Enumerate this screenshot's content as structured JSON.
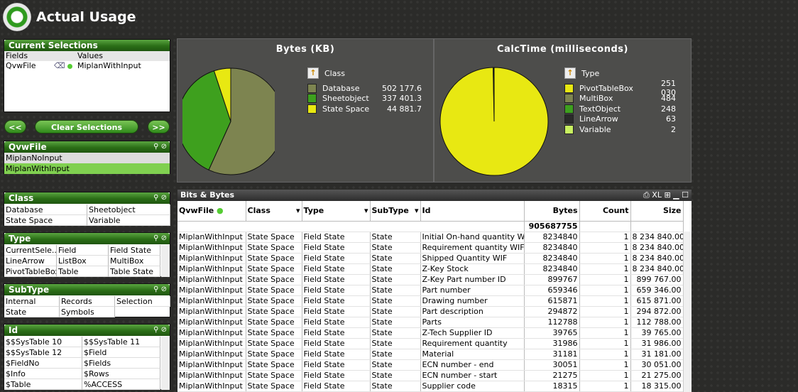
{
  "app": {
    "title": "Actual Usage"
  },
  "current_selections": {
    "title": "Current Selections",
    "col_fields": "Fields",
    "col_values": "Values",
    "rows": [
      {
        "field": "QvwFile",
        "value": "MiplanWithInput"
      }
    ]
  },
  "nav": {
    "back": "<<",
    "clear": "Clear Selections",
    "forward": ">>"
  },
  "listboxes": {
    "qvwfile": {
      "title": "QvwFile",
      "items": [
        {
          "label": "MiplanNoInput",
          "selected": false
        },
        {
          "label": "MiplanWithInput",
          "selected": true
        }
      ]
    },
    "class": {
      "title": "Class",
      "items": [
        "Database",
        "Sheetobject",
        "State Space",
        "Variable"
      ]
    },
    "type": {
      "title": "Type",
      "items": [
        "CurrentSele...",
        "Field",
        "Field State",
        "LineArrow",
        "ListBox",
        "MultiBox",
        "PivotTableBox",
        "Table",
        "Table State"
      ]
    },
    "subtype": {
      "title": "SubType",
      "items": [
        "Internal",
        "Records",
        "Selection",
        "State",
        "Symbols",
        ""
      ]
    },
    "id": {
      "title": "Id",
      "items": [
        "$$SysTable 10",
        "$$SysTable 11",
        "$$SysTable 12",
        "$Field",
        "$FieldNo",
        "$Fields",
        "$Info",
        "$Rows",
        "$Table",
        "%ACCESS"
      ]
    }
  },
  "chart_data": [
    {
      "type": "pie",
      "title": "Bytes (KB)",
      "legend_title": "Class",
      "legend": "right",
      "slices": [
        {
          "label": "Database",
          "value": 502177.6,
          "display": "502 177.6",
          "color": "#7d8450"
        },
        {
          "label": "Sheetobject",
          "value": 337401.3,
          "display": "337 401.3",
          "color": "#3ea01e"
        },
        {
          "label": "State Space",
          "value": 44881.7,
          "display": "44 881.7",
          "color": "#e8e812"
        }
      ]
    },
    {
      "type": "pie",
      "title": "CalcTime (milliseconds)",
      "legend_title": "Type",
      "legend": "right",
      "slices": [
        {
          "label": "PivotTableBox",
          "value": 251030,
          "display": "251 030",
          "color": "#e8e812"
        },
        {
          "label": "MultiBox",
          "value": 484,
          "display": "484",
          "color": "#7d8450"
        },
        {
          "label": "TextObject",
          "value": 248,
          "display": "248",
          "color": "#3ea01e"
        },
        {
          "label": "LineArrow",
          "value": 63,
          "display": "63",
          "color": "#2a2a2a"
        },
        {
          "label": "Variable",
          "value": 2,
          "display": "2",
          "color": "#c8f060"
        }
      ]
    }
  ],
  "table": {
    "title": "Bits & Bytes",
    "toolbar": "XL",
    "columns": [
      "QvwFile",
      "Class",
      "Type",
      "SubType",
      "Id",
      "Bytes",
      "Count",
      "Size"
    ],
    "total_bytes": "905687755",
    "rows": [
      [
        "MiplanWithInput",
        "State Space",
        "Field State",
        "State",
        "Initial On-hand quantity WIF",
        "8234840",
        "1",
        "8 234 840.00"
      ],
      [
        "MiplanWithInput",
        "State Space",
        "Field State",
        "State",
        "Requirement quantity WIF",
        "8234840",
        "1",
        "8 234 840.00"
      ],
      [
        "MiplanWithInput",
        "State Space",
        "Field State",
        "State",
        "Shipped Quantity WIF",
        "8234840",
        "1",
        "8 234 840.00"
      ],
      [
        "MiplanWithInput",
        "State Space",
        "Field State",
        "State",
        "Z-Key Stock",
        "8234840",
        "1",
        "8 234 840.00"
      ],
      [
        "MiplanWithInput",
        "State Space",
        "Field State",
        "State",
        "Z-Key Part number ID",
        "899767",
        "1",
        "899 767.00"
      ],
      [
        "MiplanWithInput",
        "State Space",
        "Field State",
        "State",
        "Part number",
        "659346",
        "1",
        "659 346.00"
      ],
      [
        "MiplanWithInput",
        "State Space",
        "Field State",
        "State",
        "Drawing number",
        "615871",
        "1",
        "615 871.00"
      ],
      [
        "MiplanWithInput",
        "State Space",
        "Field State",
        "State",
        "Part description",
        "294872",
        "1",
        "294 872.00"
      ],
      [
        "MiplanWithInput",
        "State Space",
        "Field State",
        "State",
        "Parts",
        "112788",
        "1",
        "112 788.00"
      ],
      [
        "MiplanWithInput",
        "State Space",
        "Field State",
        "State",
        "Z-Tech Supplier ID",
        "39765",
        "1",
        "39 765.00"
      ],
      [
        "MiplanWithInput",
        "State Space",
        "Field State",
        "State",
        "Requirement quantity",
        "31986",
        "1",
        "31 986.00"
      ],
      [
        "MiplanWithInput",
        "State Space",
        "Field State",
        "State",
        "Material",
        "31181",
        "1",
        "31 181.00"
      ],
      [
        "MiplanWithInput",
        "State Space",
        "Field State",
        "State",
        "ECN number - end",
        "30051",
        "1",
        "30 051.00"
      ],
      [
        "MiplanWithInput",
        "State Space",
        "Field State",
        "State",
        "ECN number - start",
        "21275",
        "1",
        "21 275.00"
      ],
      [
        "MiplanWithInput",
        "State Space",
        "Field State",
        "State",
        "Supplier code",
        "18315",
        "1",
        "18 315.00"
      ]
    ]
  }
}
